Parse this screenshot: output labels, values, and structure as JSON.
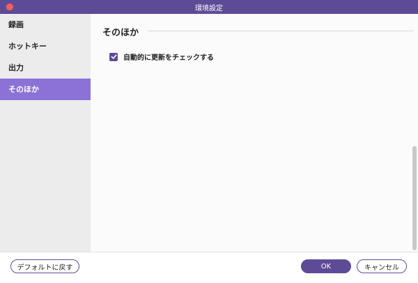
{
  "window": {
    "title": "環境設定"
  },
  "sidebar": {
    "items": [
      {
        "label": "録画"
      },
      {
        "label": "ホットキー"
      },
      {
        "label": "出力"
      },
      {
        "label": "そのほか"
      }
    ],
    "active_index": 3
  },
  "section": {
    "title": "そのほか"
  },
  "settings": {
    "auto_update": {
      "label": "自動的に更新をチェックする",
      "checked": true
    }
  },
  "footer": {
    "reset_label": "デフォルトに戻す",
    "ok_label": "OK",
    "cancel_label": "キャンセル"
  },
  "colors": {
    "accent": "#5e4b97",
    "sidebar_active": "#8b72d6",
    "close_button": "#ff5f57"
  }
}
